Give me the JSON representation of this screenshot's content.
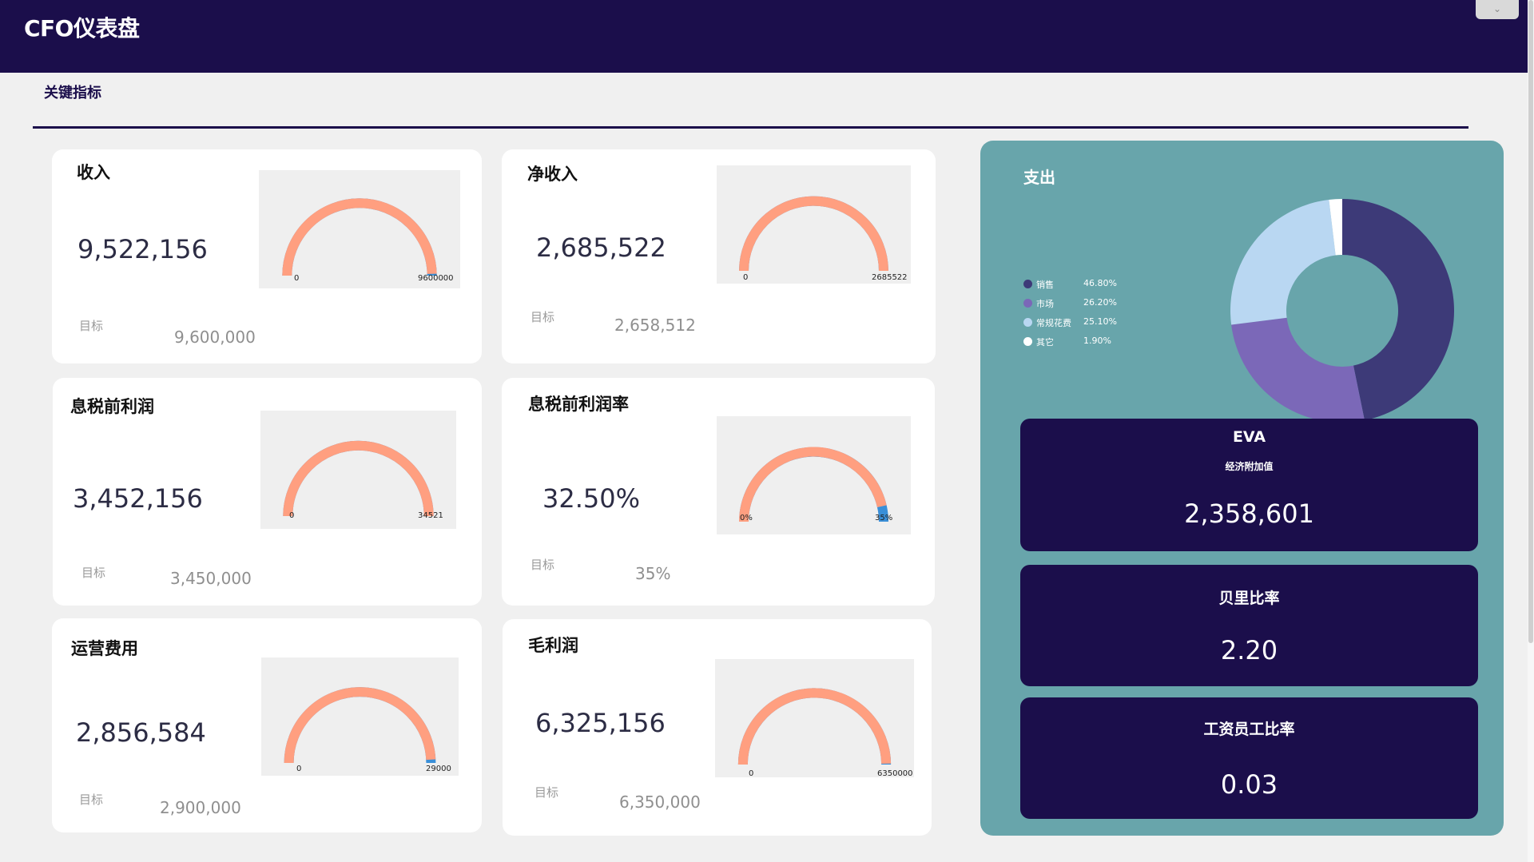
{
  "app": {
    "title": "CFO仪表盘",
    "dropdown_icon": "chevron-down-icon"
  },
  "section": {
    "title": "关键指标"
  },
  "target_label": "目标",
  "cards": [
    {
      "title": "收入",
      "value": "9,522,156",
      "target": "9,600,000",
      "gauge_min": "0",
      "gauge_max": "9600000",
      "progress": 0.992
    },
    {
      "title": "净收入",
      "value": "2,685,522",
      "target": "2,658,512",
      "gauge_min": "0",
      "gauge_max": "2685522",
      "progress": 1.0
    },
    {
      "title": "息税前利润",
      "value": "3,452,156",
      "target": "3,450,000",
      "gauge_min": "0",
      "gauge_max": "34521",
      "progress": 1.0
    },
    {
      "title": "息税前利润率",
      "value": "32.50%",
      "target": "35%",
      "gauge_min": "0%",
      "gauge_max": "35%",
      "progress": 0.929
    },
    {
      "title": "运营费用",
      "value": "2,856,584",
      "target": "2,900,000",
      "gauge_min": "0",
      "gauge_max": "29000",
      "progress": 0.985
    },
    {
      "title": "毛利润",
      "value": "6,325,156",
      "target": "6,350,000",
      "gauge_min": "0",
      "gauge_max": "6350000",
      "progress": 0.996
    }
  ],
  "colors": {
    "gauge_fill": "#ff9f80",
    "gauge_rest": "#3a8fd8",
    "gauge_bg": "#efefef",
    "header": "#1b0e4b",
    "panel": "#68a5ab"
  },
  "expenses": {
    "title": "支出",
    "items": [
      {
        "label": "销售",
        "pct_text": "46.80%",
        "value": 46.8,
        "color": "#3d3a78"
      },
      {
        "label": "市场",
        "pct_text": "26.20%",
        "value": 26.2,
        "color": "#7b68b8"
      },
      {
        "label": "常规花费",
        "pct_text": "25.10%",
        "value": 25.1,
        "color": "#b9d7f2"
      },
      {
        "label": "其它",
        "pct_text": "1.90%",
        "value": 1.9,
        "color": "#ffffff"
      }
    ]
  },
  "kpis": {
    "eva": {
      "title": "EVA",
      "subtitle": "经济附加值",
      "value": "2,358,601"
    },
    "berry": {
      "title": "贝里比率",
      "value": "2.20"
    },
    "payroll": {
      "title": "工资员工比率",
      "value": "0.03"
    }
  }
}
